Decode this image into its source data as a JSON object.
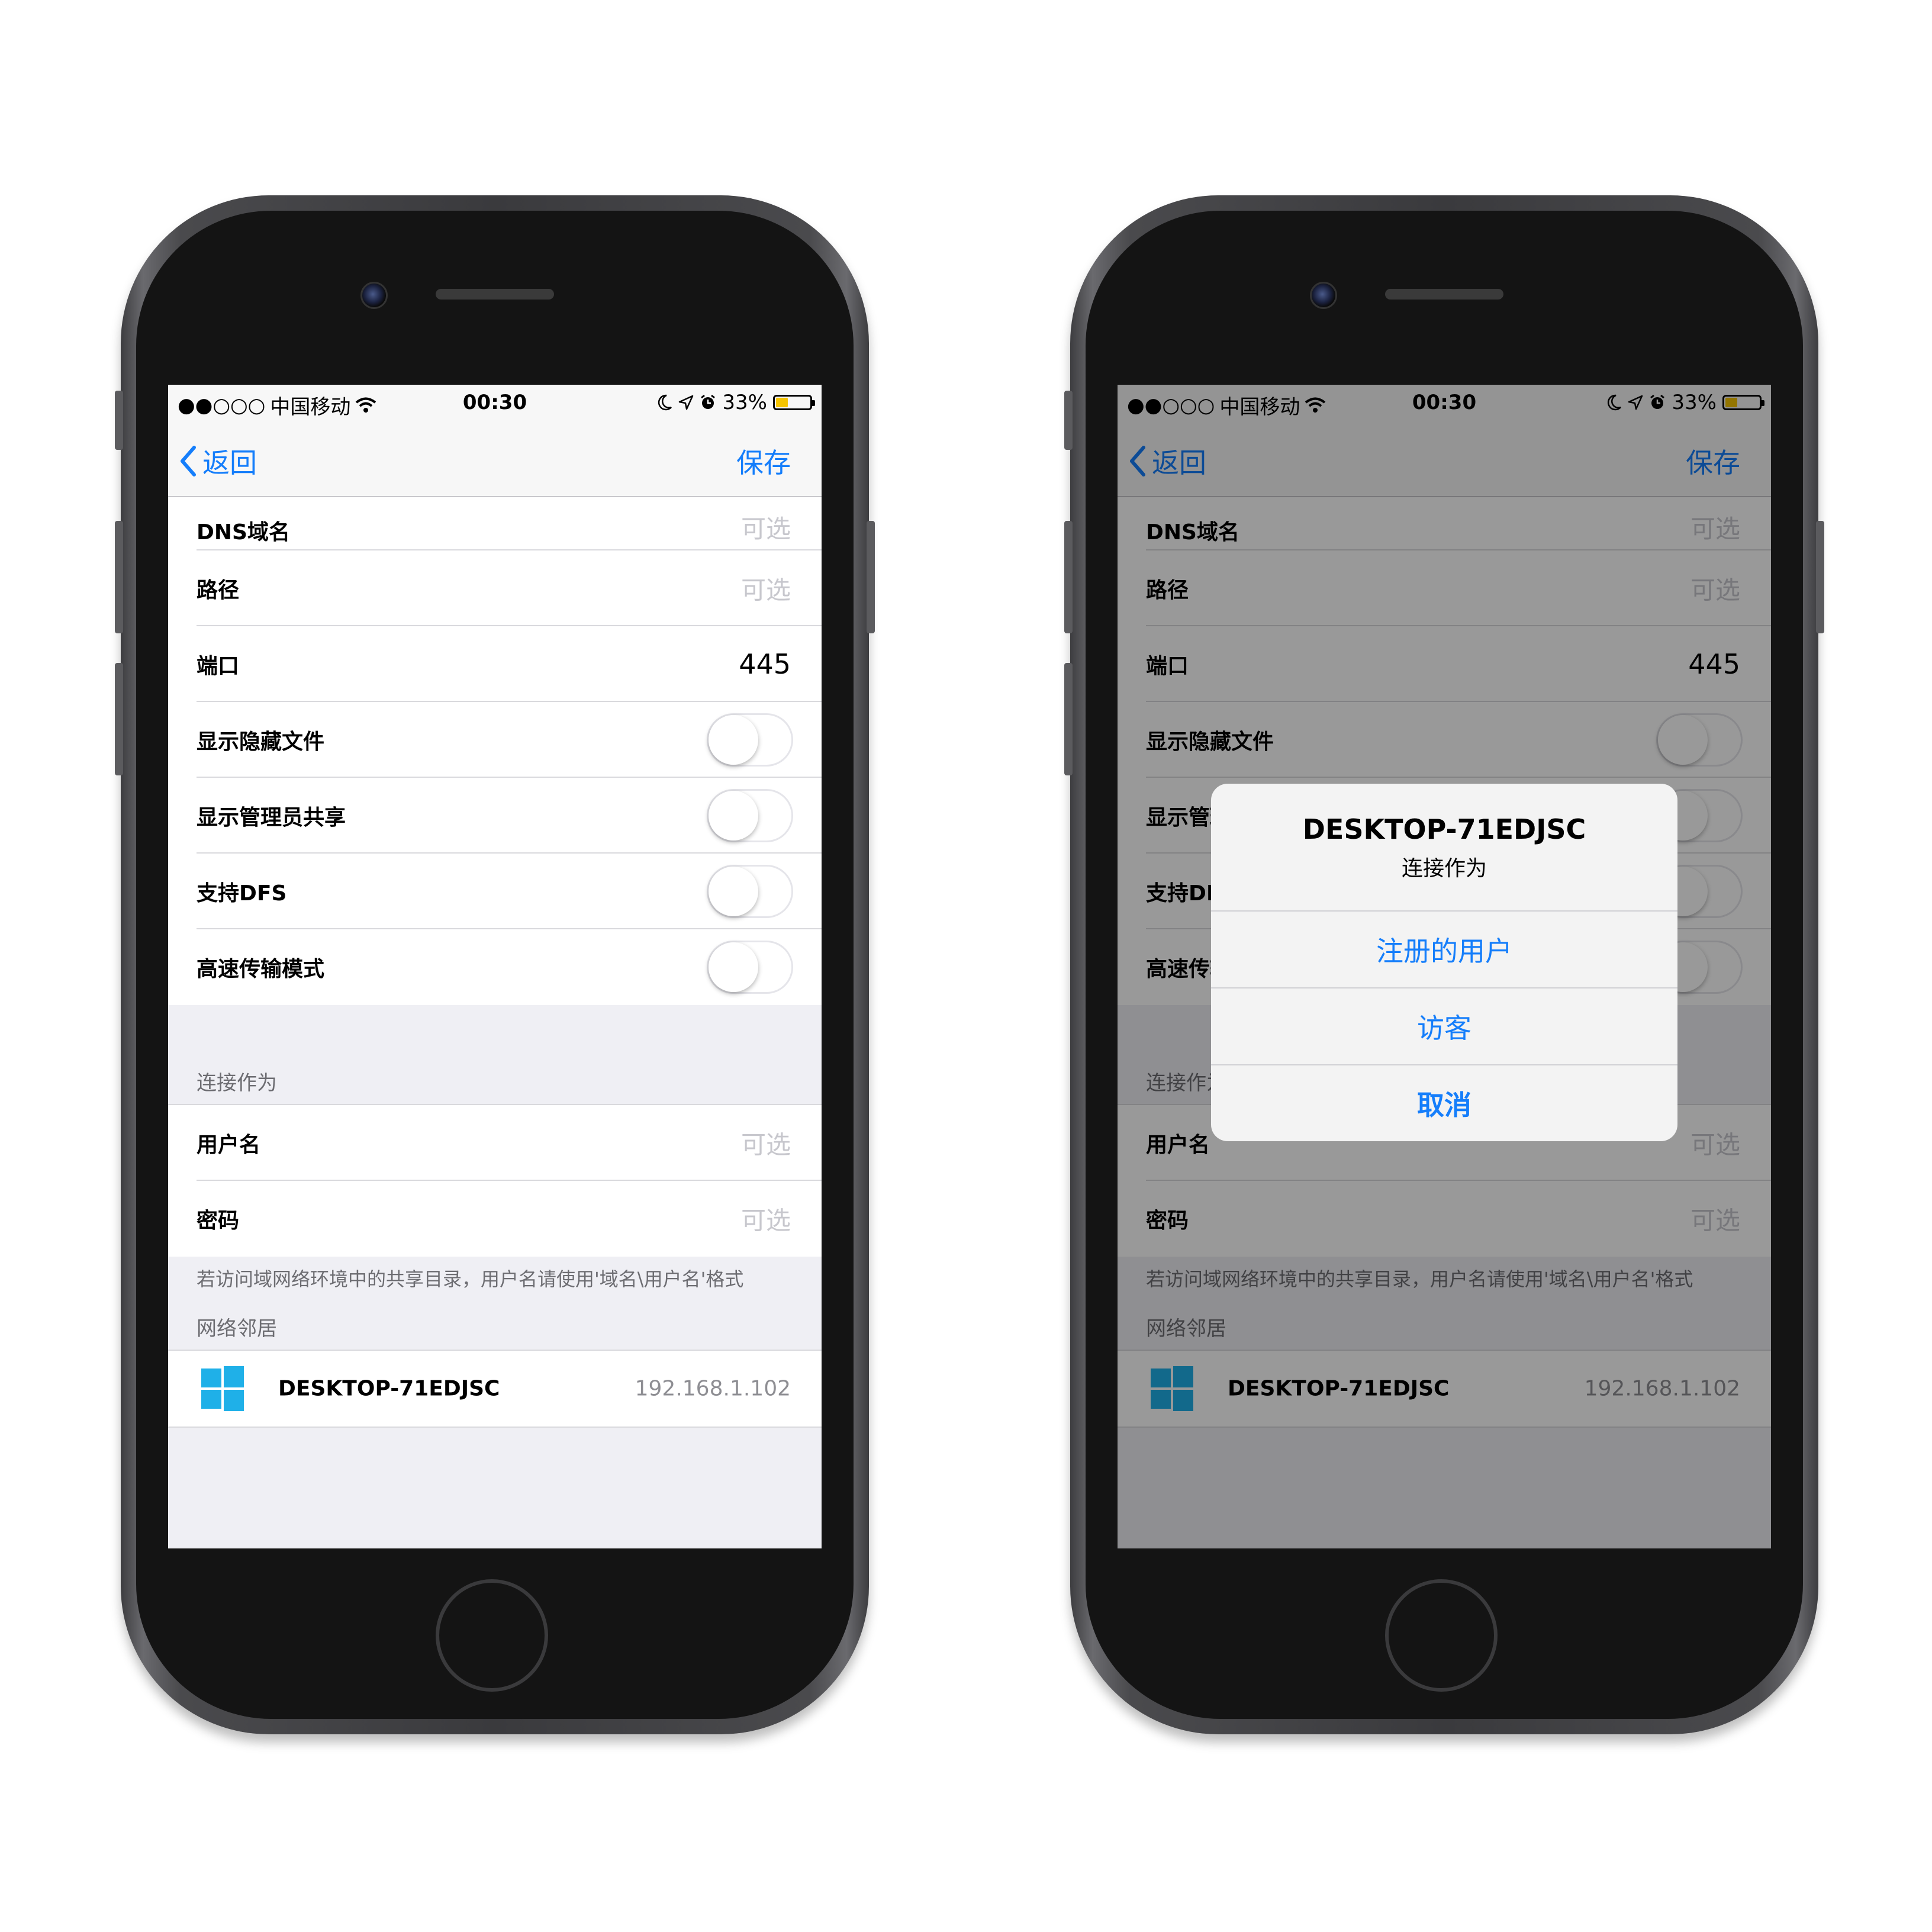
{
  "status_bar": {
    "signal": "●●○○○",
    "carrier": "中国移动",
    "time": "00:30",
    "battery_percent": "33%",
    "battery_level": 0.33
  },
  "nav": {
    "back_label": "返回",
    "save_label": "保存"
  },
  "settings_rows": [
    {
      "label": "DNS域名",
      "value": "可选"
    },
    {
      "label": "路径",
      "value": "可选"
    },
    {
      "label": "端口",
      "value": "445"
    },
    {
      "label": "显示隐藏文件",
      "toggle": false
    },
    {
      "label": "显示管理员共享",
      "toggle": false
    },
    {
      "label": "支持DFS",
      "toggle": false
    },
    {
      "label": "高速传输模式",
      "toggle": false
    }
  ],
  "connect_section": {
    "header": "连接作为",
    "rows": [
      {
        "label": "用户名",
        "value": "可选"
      },
      {
        "label": "密码",
        "value": "可选"
      }
    ],
    "footer": "若访问域网络环境中的共享目录，用户名请使用'域名\\用户名'格式"
  },
  "neighbors_section": {
    "header": "网络邻居",
    "items": [
      {
        "name": "DESKTOP-71EDJSC",
        "ip": "192.168.1.102",
        "icon": "windows-logo-icon"
      }
    ]
  },
  "alert": {
    "title": "DESKTOP-71EDJSC",
    "message": "连接作为",
    "actions": [
      "注册的用户",
      "访客",
      "取消"
    ]
  },
  "colors": {
    "accent": "#157efb",
    "windows_blue": "#1fb0e8",
    "battery_yellow": "#f5c400"
  }
}
